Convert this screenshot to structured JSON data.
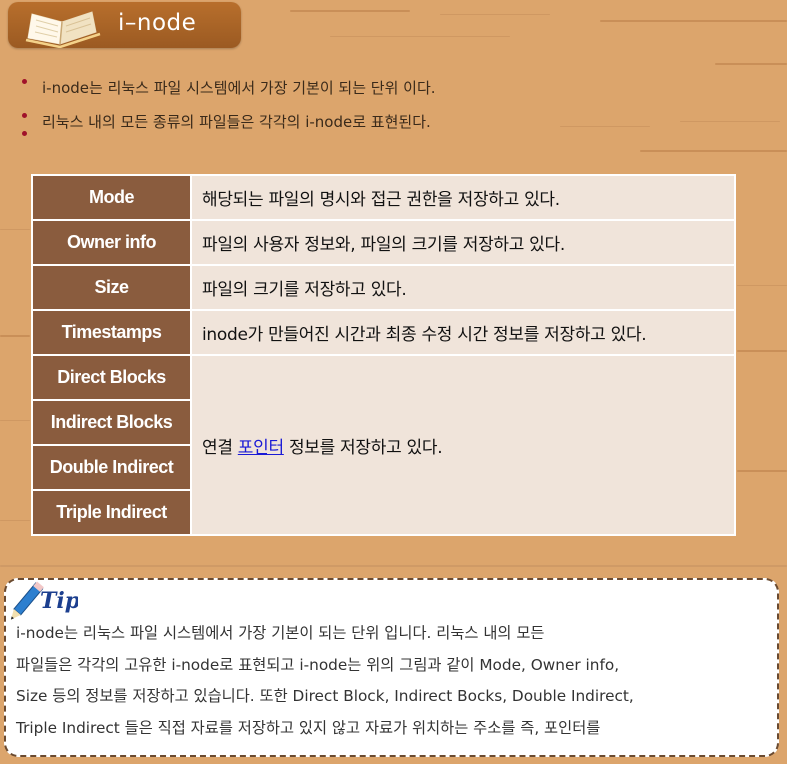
{
  "header": {
    "title": "i–node",
    "icon": "open-book-icon"
  },
  "bullets": [
    "i-node는 리눅스 파일 시스템에서 가장 기본이 되는 단위 이다.",
    "리눅스 내의 모든 종류의 파일들은 각각의 i-node로 표현된다."
  ],
  "table": {
    "rows": [
      {
        "key": "Mode",
        "value": "해당되는 파일의 명시와 접근 권한을 저장하고 있다."
      },
      {
        "key": "Owner info",
        "value": "파일의 사용자 정보와, 파일의 크기를 저장하고 있다."
      },
      {
        "key": "Size",
        "value": "파일의 크기를 저장하고 있다."
      },
      {
        "key": "Timestamps",
        "value": "inode가 만들어진 시간과 최종 수정 시간 정보를 저장하고 있다."
      }
    ],
    "block_keys": [
      "Direct Blocks",
      "Indirect Blocks",
      "Double Indirect",
      "Triple Indirect"
    ],
    "block_value_prefix": "연결",
    "block_value_link": "포인터",
    "block_value_suffix": "정보를 저장하고 있다."
  },
  "tip": {
    "label": "Tip",
    "lines": [
      "i-node는 리눅스 파일 시스템에서 가장 기본이 되는 단위 입니다. 리눅스 내의 모든",
      "파일들은 각각의 고유한 i-node로 표현되고 i-node는 위의 그림과 같이 Mode, Owner info,",
      "Size 등의 정보를 저장하고 있습니다. 또한 Direct Block, Indirect Bocks, Double Indirect,",
      "Triple Indirect 들은 직접 자료를 저장하고 있지 않고 자료가 위치하는 주소를 즉, 포인터를"
    ]
  },
  "colors": {
    "background": "#dca56c",
    "header": "#a8632a",
    "key_cell": "#8a5c3e",
    "value_cell": "#f0e4da",
    "bullet": "#a0122a",
    "link": "#1a1ad6"
  }
}
